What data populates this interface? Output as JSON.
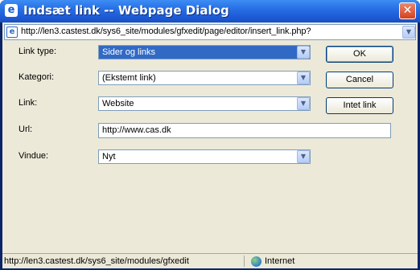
{
  "window": {
    "title": "Indsæt link -- Webpage Dialog",
    "title_icon": "ie-icon",
    "close_glyph": "✕"
  },
  "addressbar": {
    "url": "http://len3.castest.dk/sys6_site/modules/gfxedit/page/editor/insert_link.php?"
  },
  "form": {
    "link_type": {
      "label": "Link type:",
      "value": "Sider og links"
    },
    "kategori": {
      "label": "Kategori:",
      "value": "(Ekstemt link)"
    },
    "link": {
      "label": "Link:",
      "value": "Website"
    },
    "url": {
      "label": "Url:",
      "value": "http://www.cas.dk"
    },
    "vindue": {
      "label": "Vindue:",
      "value": "Nyt"
    }
  },
  "buttons": {
    "ok": "OK",
    "cancel": "Cancel",
    "no_link": "Intet link"
  },
  "statusbar": {
    "url": "http://len3.castest.dk/sys6_site/modules/gfxedit",
    "zone": "Internet"
  },
  "colors": {
    "titlebar": "#1d5bd6",
    "dialog_bg": "#ece9d8",
    "selection": "#316ac5",
    "close_button": "#d5401f"
  }
}
